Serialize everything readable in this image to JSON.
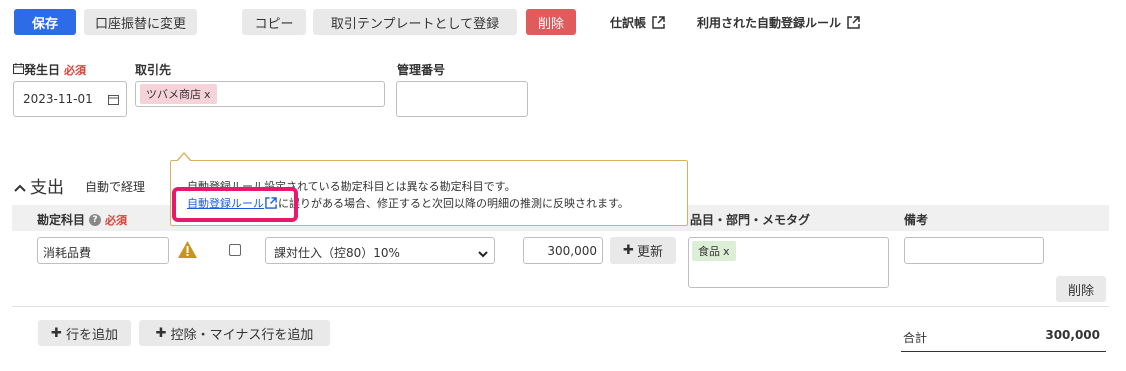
{
  "toolbar": {
    "save_label": "保存",
    "switch_label": "口座振替に変更",
    "copy_label": "コピー",
    "template_label": "取引テンプレートとして登録",
    "delete_label": "削除",
    "journal_link": "仕訳帳",
    "rule_link": "利用された自動登録ルール"
  },
  "form": {
    "date_label": "発生日",
    "date_required": "必須",
    "date_value": "2023-11-01",
    "partner_label": "取引先",
    "partner_tag": "ツバメ商店",
    "mgmt_label": "管理番号",
    "mgmt_value": ""
  },
  "expense": {
    "title": "支出",
    "auto_label": "自動で経理"
  },
  "table": {
    "col_account": "勘定科目",
    "col_account_required": "必須",
    "col_tags": "品目・部門・メモタグ",
    "col_note": "備考",
    "row": {
      "account": "消耗品費",
      "tax": "課対仕入（控80）10%",
      "amount": "300,000",
      "update_label": "更新",
      "tag": "食品",
      "note": "",
      "delete_label": "削除"
    }
  },
  "tooltip": {
    "line1": "自動登録ルール設定されている勘定科目とは異なる勘定科目です。",
    "link": "自動登録ルール",
    "line2_rest": "に誤りがある場合、修正すると次回以降の明細の推測に反映されます。"
  },
  "footer": {
    "add_row": "行を追加",
    "add_deduction_row": "控除・マイナス行を追加",
    "total_label": "合計",
    "total_value": "300,000"
  },
  "colors": {
    "primary": "#2e6be6",
    "danger": "#e05b5b",
    "highlight": "#e6196b",
    "warning": "#c8941e"
  }
}
